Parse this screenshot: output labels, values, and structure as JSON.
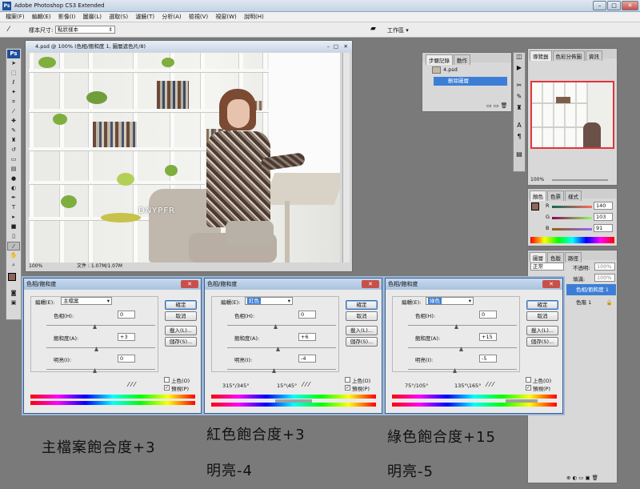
{
  "app": {
    "title": "Adobe Photoshop CS3 Extended",
    "logo": "Ps"
  },
  "menu": [
    "檔案(F)",
    "編輯(E)",
    "影像(I)",
    "圖層(L)",
    "選取(S)",
    "濾鏡(T)",
    "分析(A)",
    "檢視(V)",
    "視窗(W)",
    "說明(H)"
  ],
  "options": {
    "sample_label": "樣本尺寸:",
    "sample_value": "點狀樣本",
    "workspace": "工作區 ▾"
  },
  "document": {
    "title": "4.psd @ 100% (色相/飽和度 1, 圖層遮色片/8)",
    "zoom": "100%",
    "file_info": "文件 : 1.07M/1.07M",
    "watermark": "DNYPFR"
  },
  "history": {
    "tabs": [
      "步驟記錄",
      "動作"
    ],
    "items": [
      "4.psd",
      "刪除圖層"
    ]
  },
  "navigator": {
    "tabs": [
      "導覽器",
      "色彩分佈圖",
      "資訊"
    ],
    "zoom": "100%"
  },
  "color_panel": {
    "tabs": [
      "顏色",
      "色票",
      "樣式"
    ],
    "r": "140",
    "g": "103",
    "b": "91",
    "fg_color": "#8c675b"
  },
  "layers": {
    "tabs": [
      "圖層",
      "色版",
      "路徑"
    ],
    "mode": "正常",
    "opacity_label": "不透明:",
    "opacity": "100%",
    "lock_label": "鎖定:",
    "fill_label": "填滿:",
    "fill": "100%",
    "items": [
      "色相/飽和度 1",
      "色階 1"
    ]
  },
  "dialogs": [
    {
      "title": "色相/飽和度",
      "edit_label": "編輯(E):",
      "edit_value": "主檔案",
      "hue_label": "色相(H):",
      "hue": "0",
      "sat_label": "飽和度(A):",
      "sat": "+3",
      "light_label": "明亮(I):",
      "light": "0",
      "range_left": "",
      "range_right": "",
      "caption1": "主檔案飽合度+3",
      "caption2": ""
    },
    {
      "title": "色相/飽和度",
      "edit_label": "編輯(E):",
      "edit_value": "紅色",
      "hue_label": "色相(H):",
      "hue": "0",
      "sat_label": "飽和度(A):",
      "sat": "+6",
      "light_label": "明亮(I):",
      "light": "-4",
      "range_left": "315°/345°",
      "range_right": "15°\\45°",
      "caption1": "紅色飽合度+3",
      "caption2": "明亮-4"
    },
    {
      "title": "色相/飽和度",
      "edit_label": "編輯(E):",
      "edit_value": "綠色",
      "hue_label": "色相(H):",
      "hue": "0",
      "sat_label": "飽和度(A):",
      "sat": "+15",
      "light_label": "明亮(I):",
      "light": "-5",
      "range_left": "75°/105°",
      "range_right": "135°\\165°",
      "caption1": "綠色飽合度+15",
      "caption2": "明亮-5"
    }
  ],
  "dialog_buttons": {
    "ok": "確定",
    "cancel": "取消",
    "load": "載入(L)...",
    "save": "儲存(S)...",
    "colorize": "上色(O)",
    "preview": "預視(P)"
  }
}
